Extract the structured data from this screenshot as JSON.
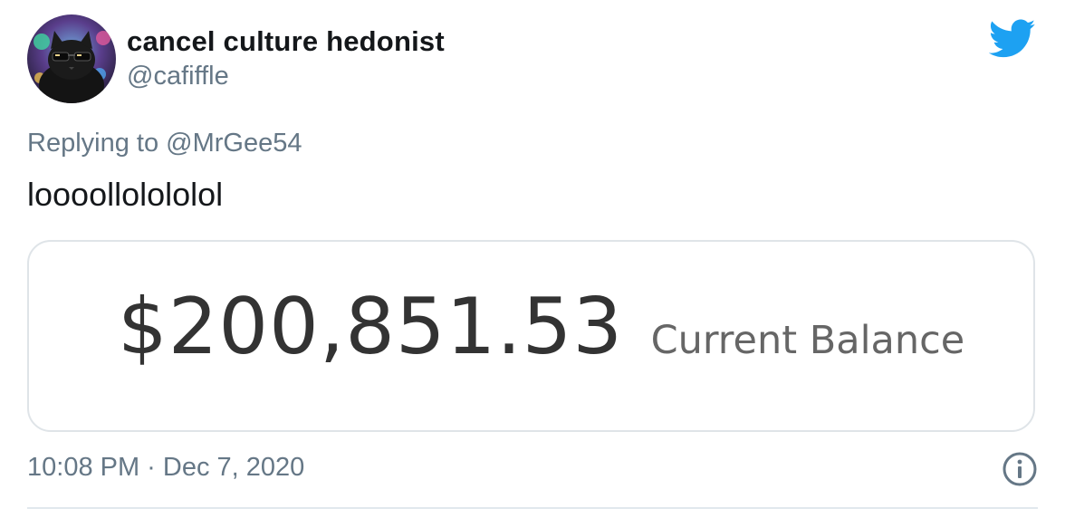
{
  "tweet": {
    "display_name": "cancel culture hedonist",
    "handle": "@cafiffle",
    "replying_prefix": "Replying to",
    "replying_to": "@MrGee54",
    "text": "loooollolololol",
    "timestamp": "10:08 PM · Dec 7, 2020"
  },
  "card": {
    "balance_amount": "$200,851.53",
    "balance_label": "Current Balance"
  },
  "icons": {
    "avatar": "avatar-cat-with-sunglasses",
    "brand": "twitter-bird-icon",
    "info": "info-icon"
  },
  "colors": {
    "brand_blue": "#1da1f2",
    "text_primary": "#14171a",
    "text_secondary": "#657786",
    "card_border": "#dfe4e8",
    "balance_amount": "#333333",
    "balance_label": "#666666"
  }
}
